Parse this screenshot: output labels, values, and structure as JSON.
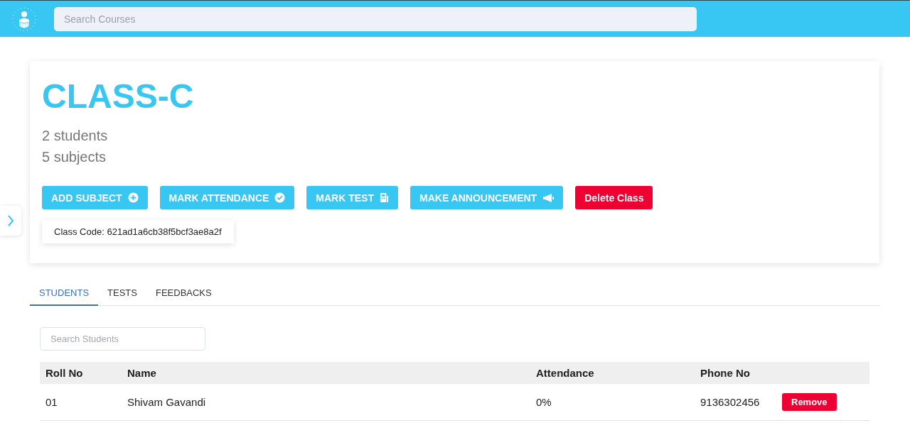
{
  "header": {
    "search": {
      "placeholder": "Search Courses"
    }
  },
  "sidebar_toggle": {
    "expanded": false
  },
  "class": {
    "title": "CLASS-C",
    "students": "2 students",
    "subjects": "5 subjects",
    "actions": [
      {
        "label": "ADD SUBJECT",
        "kind": "add"
      },
      {
        "label": "MARK ATTENDANCE",
        "kind": "attendance"
      },
      {
        "label": "MARK TEST",
        "kind": "test"
      },
      {
        "label": "MAKE ANNOUNCEMENT",
        "kind": "announce"
      },
      {
        "label": "Delete Class",
        "kind": "delete"
      }
    ],
    "class_code": "Class Code: 621ad1a6cb38f5bcf3ae8a2f"
  },
  "tabs": [
    {
      "label": "STUDENTS",
      "selected": true
    },
    {
      "label": "TESTS",
      "selected": false
    },
    {
      "label": "FEEDBACKS",
      "selected": false
    }
  ],
  "student_search": {
    "placeholder": "Search Students"
  },
  "table": {
    "columns": [
      "Roll No",
      "Name",
      "Attendance",
      "Phone No"
    ],
    "rows": [
      {
        "roll": "01",
        "name": "Shivam Gavandi",
        "attendance": "0%",
        "phone": "9136302456",
        "action": "Remove"
      }
    ]
  }
}
